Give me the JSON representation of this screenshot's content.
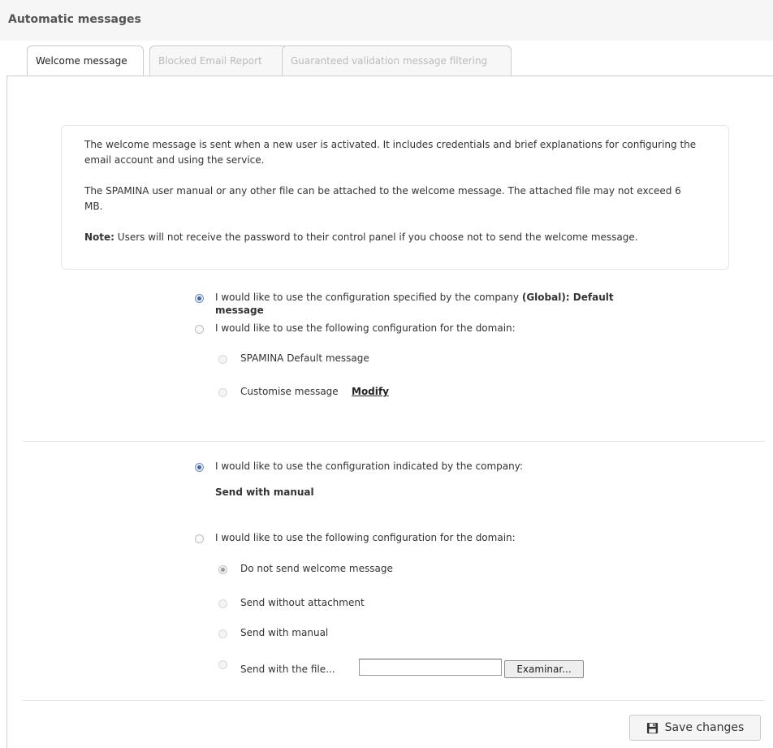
{
  "header": {
    "title": "Automatic messages"
  },
  "tabs": [
    {
      "label": "Welcome message"
    },
    {
      "label": "Blocked Email Report"
    },
    {
      "label": "Guaranteed validation message filtering"
    }
  ],
  "info": {
    "para1": "The welcome message is sent when a new user is activated. It includes credentials and brief explanations for configuring the email account and using the service.",
    "para2": "The SPAMINA user manual or any other file can be attached to the welcome message. The attached file may not exceed 6 MB.",
    "note_label": "Note:",
    "note_text": " Users will not receive the password to their control panel if you choose not to send the welcome message."
  },
  "section1": {
    "option_company": "I would like to use the configuration specified by the company ",
    "option_company_bold": "(Global): Default",
    "option_company_bold2": "message",
    "option_domain": "I would like to use the following configuration for the domain:",
    "sub_default": "SPAMINA Default message",
    "sub_custom": "Customise message",
    "modify_link": "Modify"
  },
  "section2": {
    "option_company": "I would like to use the configuration indicated by the company:",
    "company_value": "Send with manual",
    "option_domain": "I would like to use the following configuration for the domain:",
    "sub_no_send": "Do not send welcome message",
    "sub_no_attach": "Send without attachment",
    "sub_manual": "Send with manual",
    "sub_file": "Send with the file...",
    "browse_label": "Examinar..."
  },
  "footer": {
    "save_label": "Save changes"
  }
}
